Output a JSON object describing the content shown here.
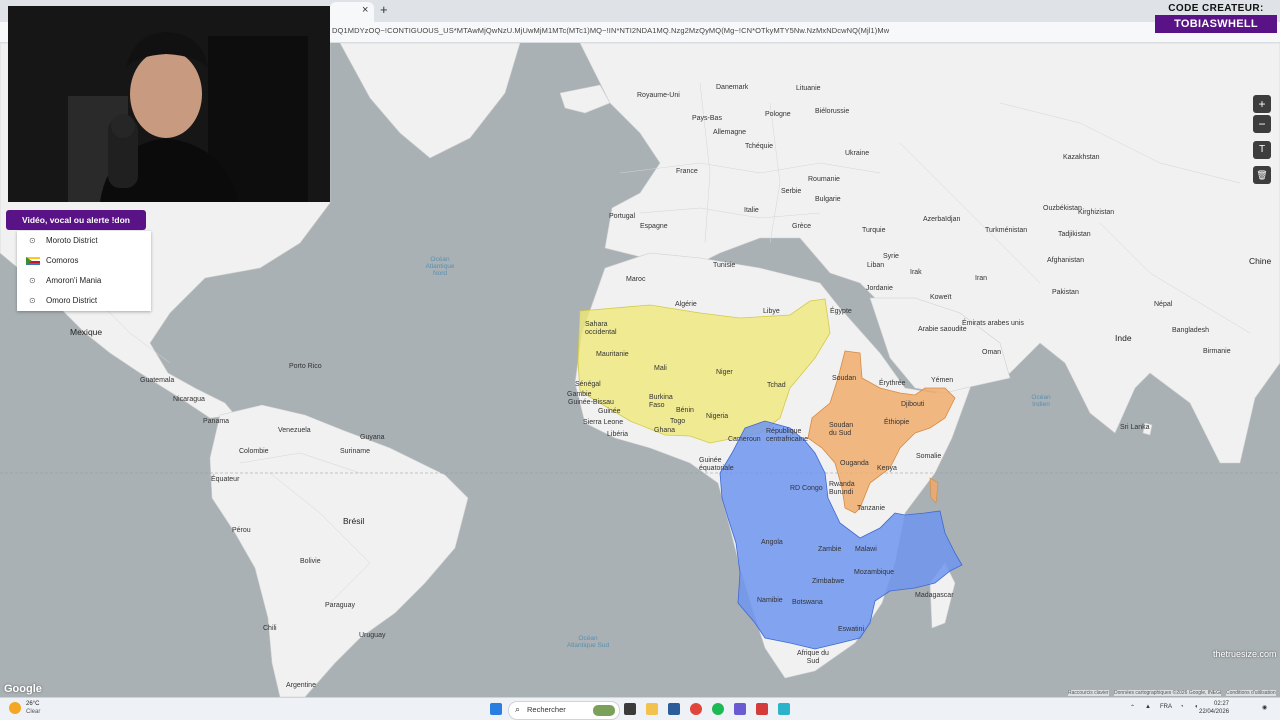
{
  "browser": {
    "tab_close": "×",
    "tab_new": "+",
    "url": "DQ1MDYzOQ~!CONTIGUOUS_US*MTAwMjQwNzU.MjUwMjM1MTc(MTc1)MQ~!IN*NTI2NDA1MQ.Nzg2MzQyMQ(Mg~!CN*OTkyMTY5Nw.NzMxNDcwNQ(Mjl1)Mw"
  },
  "creator_code": {
    "title": "CODE CREATEUR:",
    "name": "TOBIASWHELL"
  },
  "donation": {
    "button_label": "Vidéo, vocal ou alerte !don",
    "suggestions": [
      {
        "icon": "pin-icon",
        "label": "Moroto District"
      },
      {
        "icon": "flag-icon",
        "label": "Comoros"
      },
      {
        "icon": "pin-icon",
        "label": "Amoron'i Mania"
      },
      {
        "icon": "pin-icon",
        "label": "Omoro District"
      }
    ]
  },
  "map": {
    "controls": {
      "zoom_in": "+",
      "zoom_out": "−",
      "text_tool": "T",
      "delete": "🗑"
    },
    "overlay_colors": {
      "usa": "#f0ea7a",
      "india": "#f0a968",
      "china": "#6f95ef"
    },
    "labels": [
      {
        "text": "Royaume-Uni"
      },
      {
        "text": "Danemark"
      },
      {
        "text": "Lituanie"
      },
      {
        "text": "Biélorussie"
      },
      {
        "text": "Pays-Bas"
      },
      {
        "text": "Allemagne"
      },
      {
        "text": "Pologne"
      },
      {
        "text": "Ukraine"
      },
      {
        "text": "Tchéquie"
      },
      {
        "text": "France"
      },
      {
        "text": "Roumanie"
      },
      {
        "text": "Serbie"
      },
      {
        "text": "Bulgarie"
      },
      {
        "text": "Italie"
      },
      {
        "text": "Espagne"
      },
      {
        "text": "Portugal"
      },
      {
        "text": "Grèce"
      },
      {
        "text": "Turquie"
      },
      {
        "text": "Syrie"
      },
      {
        "text": "Irak"
      },
      {
        "text": "Iran"
      },
      {
        "text": "Liban"
      },
      {
        "text": "Jordanie"
      },
      {
        "text": "Tunisie"
      },
      {
        "text": "Maroc"
      },
      {
        "text": "Algérie"
      },
      {
        "text": "Libye"
      },
      {
        "text": "Égypte"
      },
      {
        "text": "Kazakhstan"
      },
      {
        "text": "Ouzbékistan"
      },
      {
        "text": "Turkménistan"
      },
      {
        "text": "Kirghizistan"
      },
      {
        "text": "Tadjikistan"
      },
      {
        "text": "Afghanistan"
      },
      {
        "text": "Pakistan"
      },
      {
        "text": "Azerbaïdjan"
      },
      {
        "text": "Koweït"
      },
      {
        "text": "Arabie saoudite"
      },
      {
        "text": "Émirats arabes unis"
      },
      {
        "text": "Oman"
      },
      {
        "text": "Yémen"
      },
      {
        "text": "Inde"
      },
      {
        "text": "Chine"
      },
      {
        "text": "Népal"
      },
      {
        "text": "Bangladesh"
      },
      {
        "text": "Birmanie"
      },
      {
        "text": "Sri Lanka"
      },
      {
        "text": "Mexique"
      },
      {
        "text": "Guatemala"
      },
      {
        "text": "Nicaragua"
      },
      {
        "text": "Panama"
      },
      {
        "text": "Porto Rico"
      },
      {
        "text": "Venezuela"
      },
      {
        "text": "Colombie"
      },
      {
        "text": "Guyana"
      },
      {
        "text": "Suriname"
      },
      {
        "text": "Équateur"
      },
      {
        "text": "Pérou"
      },
      {
        "text": "Brésil"
      },
      {
        "text": "Bolivie"
      },
      {
        "text": "Paraguay"
      },
      {
        "text": "Chili"
      },
      {
        "text": "Uruguay"
      },
      {
        "text": "Argentine"
      },
      {
        "text": "Sahara occidental"
      },
      {
        "text": "Mauritanie"
      },
      {
        "text": "Mali"
      },
      {
        "text": "Niger"
      },
      {
        "text": "Tchad"
      },
      {
        "text": "Sénégal"
      },
      {
        "text": "Gambie"
      },
      {
        "text": "Guinée-Bissau"
      },
      {
        "text": "Guinée"
      },
      {
        "text": "Sierra Leone"
      },
      {
        "text": "Libéria"
      },
      {
        "text": "Burkina Faso"
      },
      {
        "text": "Bénin"
      },
      {
        "text": "Nigeria"
      },
      {
        "text": "Ghana"
      },
      {
        "text": "Togo"
      },
      {
        "text": "Cameroun"
      },
      {
        "text": "Guinée équatoriale"
      },
      {
        "text": "République centrafricaine"
      },
      {
        "text": "Soudan"
      },
      {
        "text": "Soudan du Sud"
      },
      {
        "text": "Érythrée"
      },
      {
        "text": "Djibouti"
      },
      {
        "text": "Éthiopie"
      },
      {
        "text": "Somalie"
      },
      {
        "text": "Ouganda"
      },
      {
        "text": "Kenya"
      },
      {
        "text": "RD Congo"
      },
      {
        "text": "Rwanda"
      },
      {
        "text": "Burundi"
      },
      {
        "text": "Tanzanie"
      },
      {
        "text": "Angola"
      },
      {
        "text": "Zambie"
      },
      {
        "text": "Malawi"
      },
      {
        "text": "Mozambique"
      },
      {
        "text": "Zimbabwe"
      },
      {
        "text": "Namibie"
      },
      {
        "text": "Botswana"
      },
      {
        "text": "Madagascar"
      },
      {
        "text": "Eswatini"
      },
      {
        "text": "Afrique du Sud"
      }
    ],
    "seas": [
      {
        "text": "Océan Atlantique Nord"
      },
      {
        "text": "Océan Atlantique Sud"
      },
      {
        "text": "Océan Indien"
      }
    ],
    "google_logo": "Google",
    "site_logo": "thetruesize.com",
    "attribution": {
      "keyboard": "Raccourcis clavier",
      "data": "Données cartographiques ©2026 Google, INEGI",
      "terms": "Conditions d'utilisation"
    }
  },
  "taskbar": {
    "weather_temp": "26°C",
    "weather_desc": "Clear",
    "search_placeholder": "Rechercher",
    "lang": "FRA",
    "time": "02:27",
    "date": "22/04/2026"
  }
}
